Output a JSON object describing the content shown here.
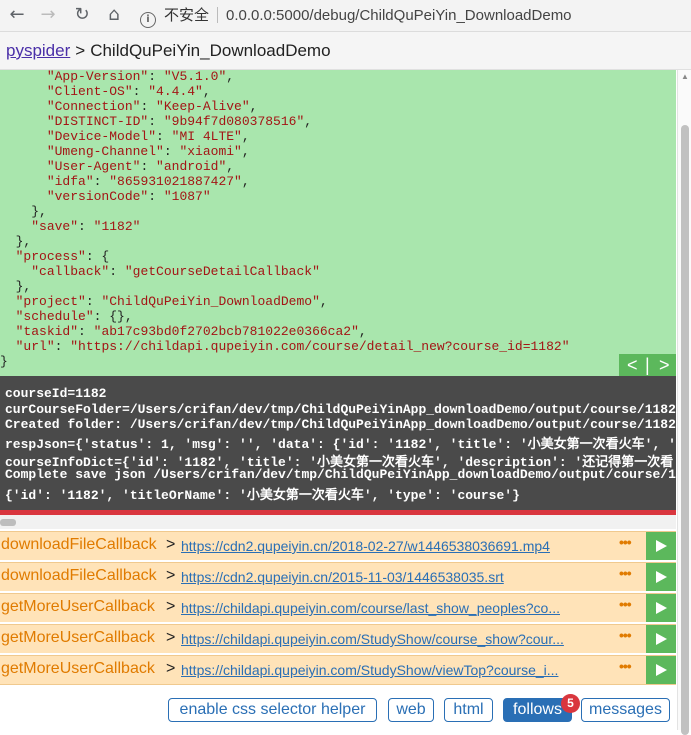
{
  "browser": {
    "back_icon": "←",
    "forward_icon": "→",
    "reload_icon": "↻",
    "home_icon": "⌂",
    "security_label": "不安全",
    "url": "0.0.0.0:5000/debug/ChildQuPeiYin_DownloadDemo"
  },
  "header": {
    "crumb": "pyspider",
    "separator": ">",
    "title": "ChildQuPeiYin_DownloadDemo"
  },
  "task_json": {
    "headers": [
      {
        "key": "\"App-Version\"",
        "value": "\"V5.1.0\"",
        "comma": ","
      },
      {
        "key": "\"Client-OS\"",
        "value": "\"4.4.4\"",
        "comma": ","
      },
      {
        "key": "\"Connection\"",
        "value": "\"Keep-Alive\"",
        "comma": ","
      },
      {
        "key": "\"DISTINCT-ID\"",
        "value": "\"9b94f7d080378516\"",
        "comma": ","
      },
      {
        "key": "\"Device-Model\"",
        "value": "\"MI 4LTE\"",
        "comma": ","
      },
      {
        "key": "\"Umeng-Channel\"",
        "value": "\"xiaomi\"",
        "comma": ","
      },
      {
        "key": "\"User-Agent\"",
        "value": "\"android\"",
        "comma": ","
      },
      {
        "key": "\"idfa\"",
        "value": "\"865931021887427\"",
        "comma": ","
      },
      {
        "key": "\"versionCode\"",
        "value": "\"1087\"",
        "comma": ""
      }
    ],
    "save_key": "\"save\"",
    "save_value": "\"1182\"",
    "process_key": "\"process\"",
    "callback_key": "\"callback\"",
    "callback_value": "\"getCourseDetailCallback\"",
    "project_key": "\"project\"",
    "project_value": "\"ChildQuPeiYin_DownloadDemo\"",
    "schedule_key": "\"schedule\"",
    "schedule_value": "{}",
    "taskid_key": "\"taskid\"",
    "taskid_value": "\"ab17c93bd0f2702bcb781022e0366ca2\"",
    "url_key": "\"url\"",
    "url_value": "\"https://childapi.qupeiyin.com/course/detail_new?course_id=1182\""
  },
  "pager": {
    "prev": "<",
    "divider": "|",
    "next": ">"
  },
  "log_lines": [
    "courseId=1182",
    "curCourseFolder=/Users/crifan/dev/tmp/ChildQuPeiYinApp_downloadDemo/output/course/1182",
    "Created folder: /Users/crifan/dev/tmp/ChildQuPeiYinApp_downloadDemo/output/course/1182",
    "respJson={'status': 1, 'msg': '', 'data': {'id': '1182', 'title': '小美女第一次看火车', '",
    "courseInfoDict={'id': '1182', 'title': '小美女第一次看火车', 'description': '还记得第一次看",
    "Complete save json /Users/crifan/dev/tmp/ChildQuPeiYinApp_downloadDemo/output/course/1",
    "{'id': '1182', 'titleOrName': '小美女第一次看火车', 'type': 'course'}"
  ],
  "follows": [
    {
      "callback": "downloadFileCallback",
      "arrow": ">",
      "url": "https://cdn2.qupeiyin.cn/2018-02-27/w1446538036691.mp4",
      "dots": "•••"
    },
    {
      "callback": "downloadFileCallback",
      "arrow": ">",
      "url": "https://cdn2.qupeiyin.cn/2015-11-03/1446538035.srt",
      "dots": "•••"
    },
    {
      "callback": "getMoreUserCallback",
      "arrow": ">",
      "url": "https://childapi.qupeiyin.com/course/last_show_peoples?co...",
      "dots": "•••"
    },
    {
      "callback": "getMoreUserCallback",
      "arrow": ">",
      "url": "https://childapi.qupeiyin.com/StudyShow/course_show?cour...",
      "dots": "•••"
    },
    {
      "callback": "getMoreUserCallback",
      "arrow": ">",
      "url": "https://childapi.qupeiyin.com/StudyShow/viewTop?course_i...",
      "dots": "•••"
    }
  ],
  "buttons": {
    "css_helper": "enable css selector helper",
    "web": "web",
    "html": "html",
    "follows": "follows",
    "follows_count": "5",
    "messages": "messages"
  },
  "colors": {
    "json_bg": "#a9e6ad",
    "log_bg": "#4a4a4a",
    "follow_bg": "#ffe3b8",
    "accent": "#2a6fb5",
    "run_green": "#5cb85c"
  }
}
